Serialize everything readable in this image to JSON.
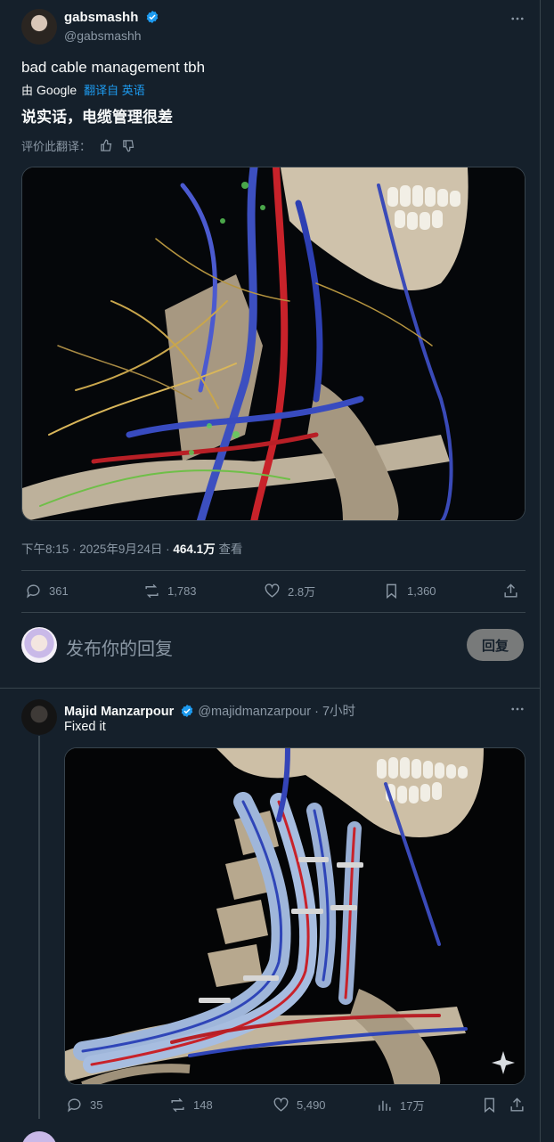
{
  "main_tweet": {
    "display_name": "gabsmashh",
    "handle": "@gabsmashh",
    "text": "bad cable management tbh",
    "translate_by": "由",
    "translate_brand": "Google",
    "translate_link": "翻译自 英语",
    "translated_text": "说实话，电缆管理很差",
    "rate_translation": "评价此翻译：",
    "time": "下午8:15",
    "date": "2025年9月24日",
    "views_count": "464.1万",
    "views_label": "查看",
    "stats": {
      "replies": "361",
      "reposts": "1,783",
      "likes": "2.8万",
      "bookmarks": "1,360"
    }
  },
  "compose": {
    "placeholder": "发布你的回复",
    "button_label": "回复"
  },
  "reply_tweet": {
    "display_name": "Majid Manzarpour",
    "handle": "@majidmanzarpour",
    "time_ago": "7小时",
    "text": "Fixed it",
    "stats": {
      "replies": "35",
      "reposts": "148",
      "likes": "5,490",
      "views": "17万"
    }
  },
  "colors": {
    "background": "#15202b",
    "text": "#f7f9f9",
    "secondary": "#8b98a5",
    "accent": "#1d9bf0",
    "divider": "#38444d"
  }
}
